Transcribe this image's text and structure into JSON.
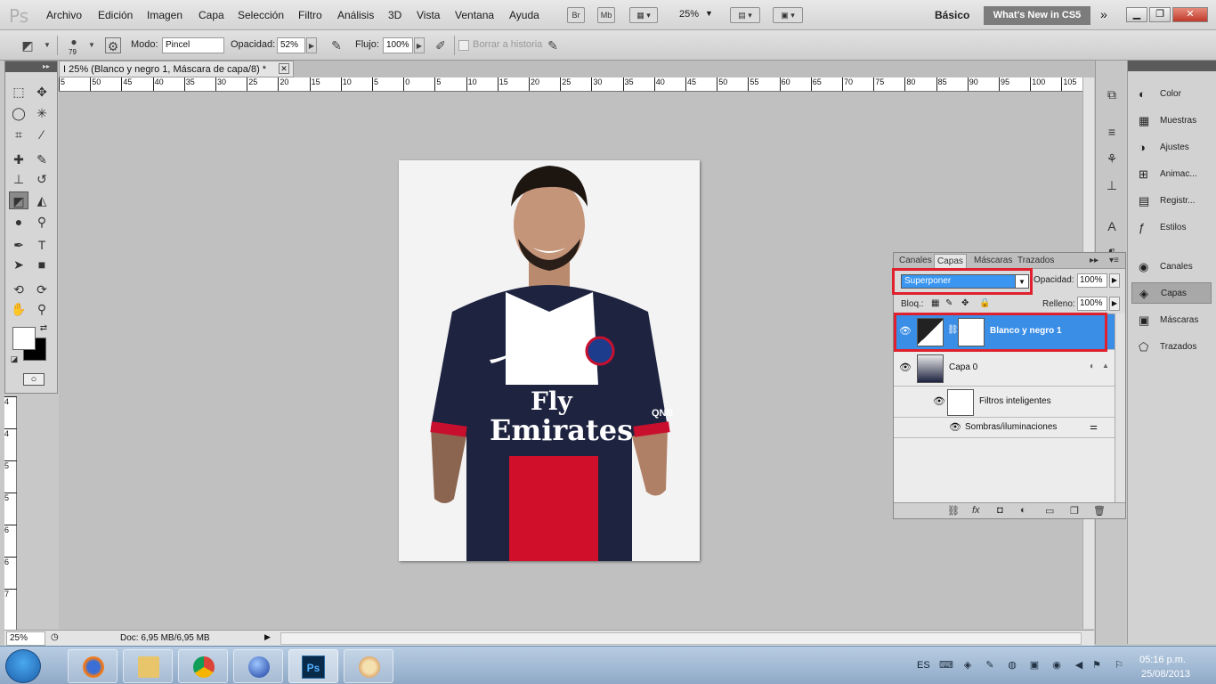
{
  "app": {
    "logo": "Ps"
  },
  "menu": [
    "Archivo",
    "Edición",
    "Imagen",
    "Capa",
    "Selección",
    "Filtro",
    "Análisis",
    "3D",
    "Vista",
    "Ventana",
    "Ayuda"
  ],
  "menubar": {
    "bridge_label": "Br",
    "minibridge_label": "Mb",
    "zoom": "25%",
    "workspace": "Básico",
    "whats_new": "What's New in CS5"
  },
  "options": {
    "brush_size": "79",
    "mode_label": "Modo:",
    "mode_value": "Pincel",
    "opacity_label": "Opacidad:",
    "opacity_value": "52%",
    "flow_label": "Flujo:",
    "flow_value": "100%",
    "erase_history_label": "Borrar a historia"
  },
  "document": {
    "tab_title": "I 25% (Blanco y negro 1, Máscara de capa/8) *",
    "ruler_top": [
      "5",
      "50",
      "45",
      "40",
      "35",
      "30",
      "25",
      "20",
      "15",
      "10",
      "5",
      "0",
      "5",
      "10",
      "15",
      "20",
      "25",
      "30",
      "35",
      "40",
      "45",
      "50",
      "55",
      "60",
      "65",
      "70",
      "75",
      "80",
      "85",
      "90",
      "95",
      "100",
      "105"
    ],
    "ruler_left": [
      "4",
      "4",
      "5",
      "5",
      "6",
      "6",
      "7"
    ],
    "photo": {
      "sponsor_line1": "Fly",
      "sponsor_line2": "Emirates",
      "sleeve_text": "QNB"
    }
  },
  "status": {
    "zoom": "25%",
    "doc_info": "Doc: 6,95 MB/6,95 MB"
  },
  "dock": {
    "items": [
      "Color",
      "Muestras",
      "Ajustes",
      "Animac...",
      "Registr...",
      "Estilos",
      "Canales",
      "Capas",
      "Máscaras",
      "Trazados"
    ]
  },
  "layers_panel": {
    "tabs": [
      "Canales",
      "Capas",
      "Máscaras",
      "Trazados"
    ],
    "blend_mode": "Superponer",
    "opacity_label": "Opacidad:",
    "opacity_value": "100%",
    "lock_label": "Bloq.:",
    "fill_label": "Relleno:",
    "fill_value": "100%",
    "layers": [
      {
        "name": "Blanco y negro 1"
      },
      {
        "name": "Capa 0"
      },
      {
        "name": "Filtros inteligentes"
      },
      {
        "name": "Sombras/iluminaciones"
      }
    ]
  },
  "taskbar": {
    "lang": "ES",
    "time": "05:16 p.m.",
    "date": "25/08/2013",
    "ps_label": "Ps"
  },
  "colors": {
    "selection_blue": "#3a8ee6",
    "highlight_red": "#e0202c",
    "foreground": "#ffffff",
    "background": "#000000"
  }
}
